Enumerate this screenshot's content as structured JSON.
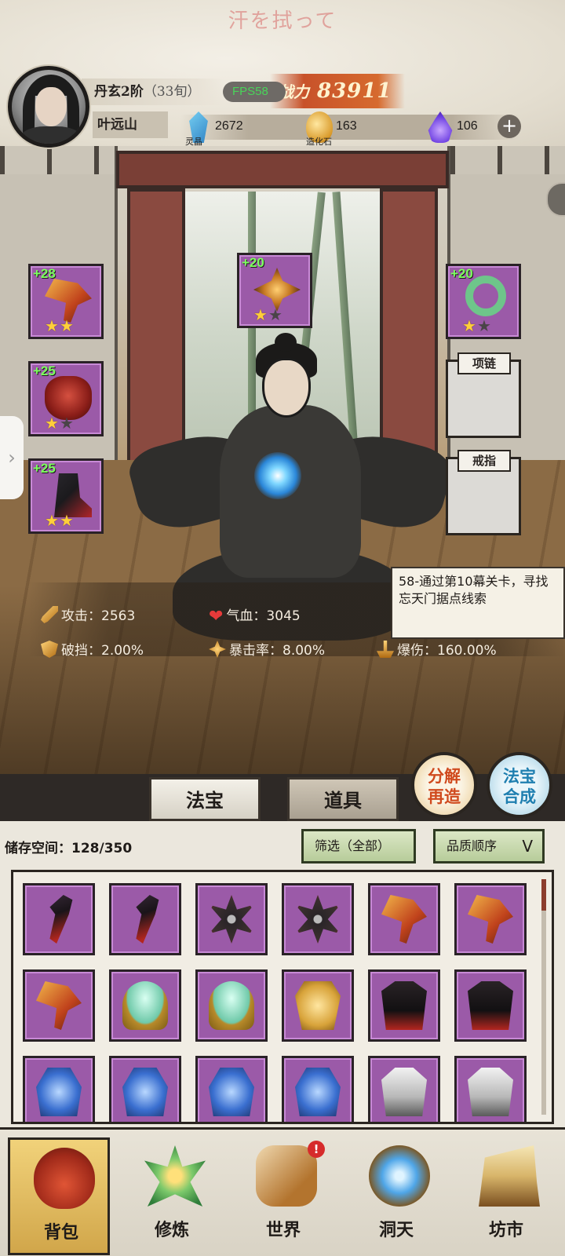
{
  "top_banner": "汗を拭って",
  "player": {
    "rank": "丹玄2阶",
    "age": "（33旬）",
    "name": "叶远山",
    "fps": "FPS58",
    "power_label": "战力",
    "power_value": "83911"
  },
  "currencies": [
    {
      "name": "灵晶",
      "value": "2672",
      "icon": "blue-crystal-icon"
    },
    {
      "name": "造化石",
      "value": "163",
      "icon": "gold-stone-icon"
    },
    {
      "name": "",
      "value": "106",
      "icon": "purple-flame-icon"
    }
  ],
  "equipment": {
    "weapon": {
      "plus": "+28",
      "stars_on": 2,
      "stars_total": 2
    },
    "helmet": {
      "plus": "+25",
      "stars_on": 1,
      "stars_total": 2
    },
    "boots": {
      "plus": "+25",
      "stars_on": 2,
      "stars_total": 2
    },
    "emblem": {
      "plus": "+20",
      "stars_on": 1,
      "stars_total": 2
    },
    "wreath": {
      "plus": "+20",
      "stars_on": 1,
      "stars_total": 2
    },
    "necklace_label": "项链",
    "ring_label": "戒指"
  },
  "quest": {
    "text": "58-通过第10幕关卡，寻找忘天门据点线索"
  },
  "stats": {
    "attack": "攻击：2563",
    "hp": "气血：3045",
    "break": "破挡：2.00%",
    "crit_rate": "暴击率：8.00%",
    "crit_dmg": "爆伤：160.00%"
  },
  "tabs": {
    "treasure": "法宝",
    "items": "道具"
  },
  "actions": {
    "decompose_top": "分解",
    "decompose_bottom": "再造",
    "synth_top": "法宝",
    "synth_bottom": "合成"
  },
  "storage": {
    "label": "储存空间：",
    "used": "128/350",
    "filter": "筛选（全部）",
    "sort": "品质顺序",
    "sort_chevron": "V"
  },
  "inventory": [
    [
      "dagger",
      "dagger",
      "shuriken",
      "shuriken",
      "axe",
      "axe"
    ],
    [
      "axe",
      "mirror",
      "mirror",
      "armor-gold",
      "robe-dark",
      "robe-dark"
    ],
    [
      "blue",
      "blue",
      "blue",
      "blue",
      "white",
      "white"
    ]
  ],
  "nav": [
    {
      "label": "背包",
      "icon": "bag-icon",
      "active": true
    },
    {
      "label": "修炼",
      "icon": "lotus-icon",
      "active": false
    },
    {
      "label": "世界",
      "icon": "scroll-icon",
      "active": false,
      "badge": "!"
    },
    {
      "label": "洞天",
      "icon": "portal-icon",
      "active": false
    },
    {
      "label": "坊市",
      "icon": "market-icon",
      "active": false
    }
  ]
}
